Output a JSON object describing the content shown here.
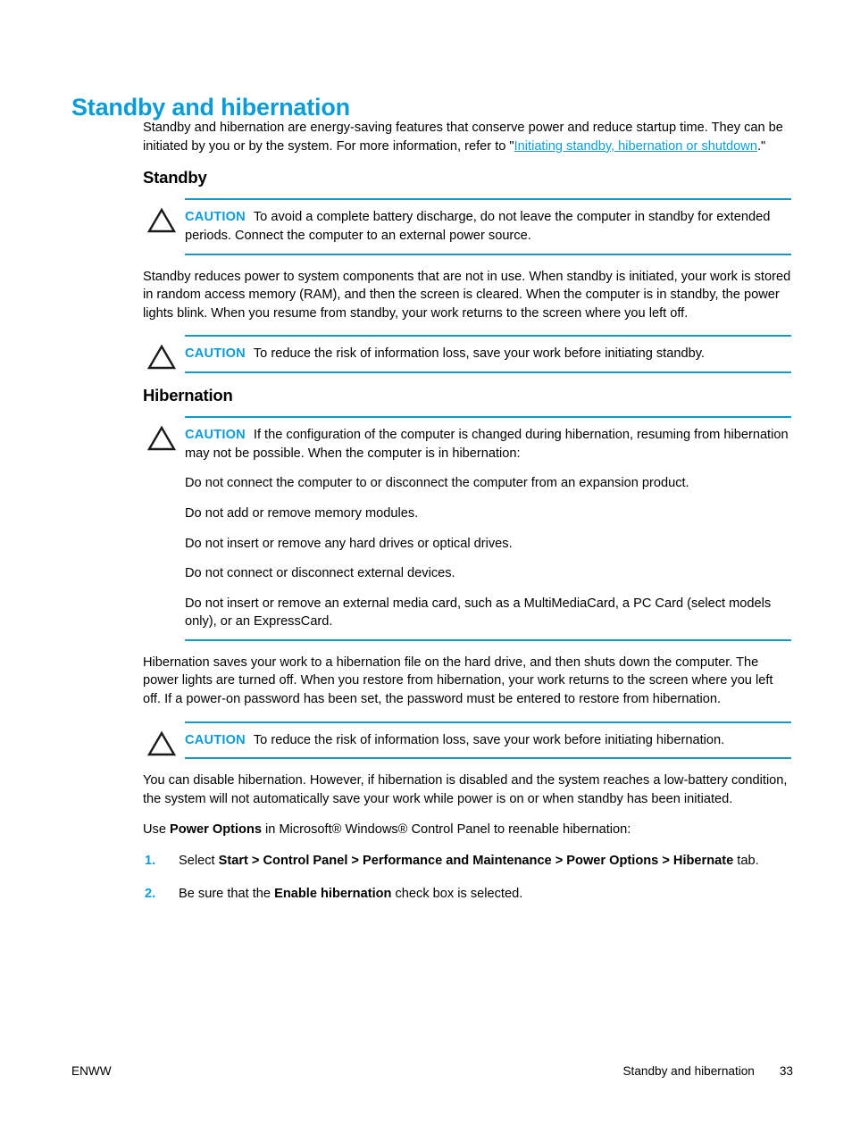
{
  "document": {
    "title": "Standby and hibernation"
  },
  "intro": {
    "part1": "Standby and hibernation are energy-saving features that conserve power and reduce startup time. They can be initiated by you or by the system. For more information, refer to \"",
    "link": "Initiating standby, hibernation or shutdown",
    "part2": ".\""
  },
  "standby": {
    "heading": "Standby",
    "caution_label_1": "CAUTION",
    "caution_text_1": "To avoid a complete battery discharge, do not leave the computer in standby for extended periods. Connect the computer to an external power source.",
    "paragraph": "Standby reduces power to system components that are not in use. When standby is initiated, your work is stored in random access memory (RAM), and then the screen is cleared. When the computer is in standby, the power lights blink. When you resume from standby, your work returns to the screen where you left off.",
    "caution_label_2": "CAUTION",
    "caution_text_2": "To reduce the risk of information loss, save your work before initiating standby."
  },
  "hibernation": {
    "heading": "Hibernation",
    "caution_label_1": "CAUTION",
    "caution_text_1": "If the configuration of the computer is changed during hibernation, resuming from hibernation may not be possible. When the computer is in hibernation:",
    "caution_items": [
      "Do not connect the computer to or disconnect the computer from an expansion product.",
      "Do not add or remove memory modules.",
      "Do not insert or remove any hard drives or optical drives.",
      "Do not connect or disconnect external devices.",
      "Do not insert or remove an external media card, such as a MultiMediaCard, a PC Card (select models only), or an ExpressCard."
    ],
    "paragraph_1": "Hibernation saves your work to a hibernation file on the hard drive, and then shuts down the computer. The power lights are turned off. When you restore from hibernation, your work returns to the screen where you left off. If a power-on password has been set, the password must be entered to restore from hibernation.",
    "caution_label_2": "CAUTION",
    "caution_text_2": "To reduce the risk of information loss, save your work before initiating hibernation.",
    "paragraph_2": "You can disable hibernation. However, if hibernation is disabled and the system reaches a low-battery condition, the system will not automatically save your work while power is on or when standby has been initiated.",
    "paragraph_3": {
      "pre": "Use ",
      "bold": "Power Options",
      "post": " in Microsoft® Windows® Control Panel to reenable hibernation:"
    },
    "steps": [
      {
        "number": "1.",
        "pre": "Select ",
        "bold": "Start > Control Panel > Performance and Maintenance > Power Options > Hibernate",
        "post": " tab."
      },
      {
        "number": "2.",
        "pre": "Be sure that the ",
        "bold": "Enable hibernation",
        "post": " check box is selected."
      }
    ]
  },
  "footer": {
    "left": "ENWW",
    "chapter": "Standby and hibernation",
    "page_number": "33"
  },
  "colors": {
    "accent": "#0b9cd8",
    "rule": "#1297cb",
    "text": "#000000"
  }
}
